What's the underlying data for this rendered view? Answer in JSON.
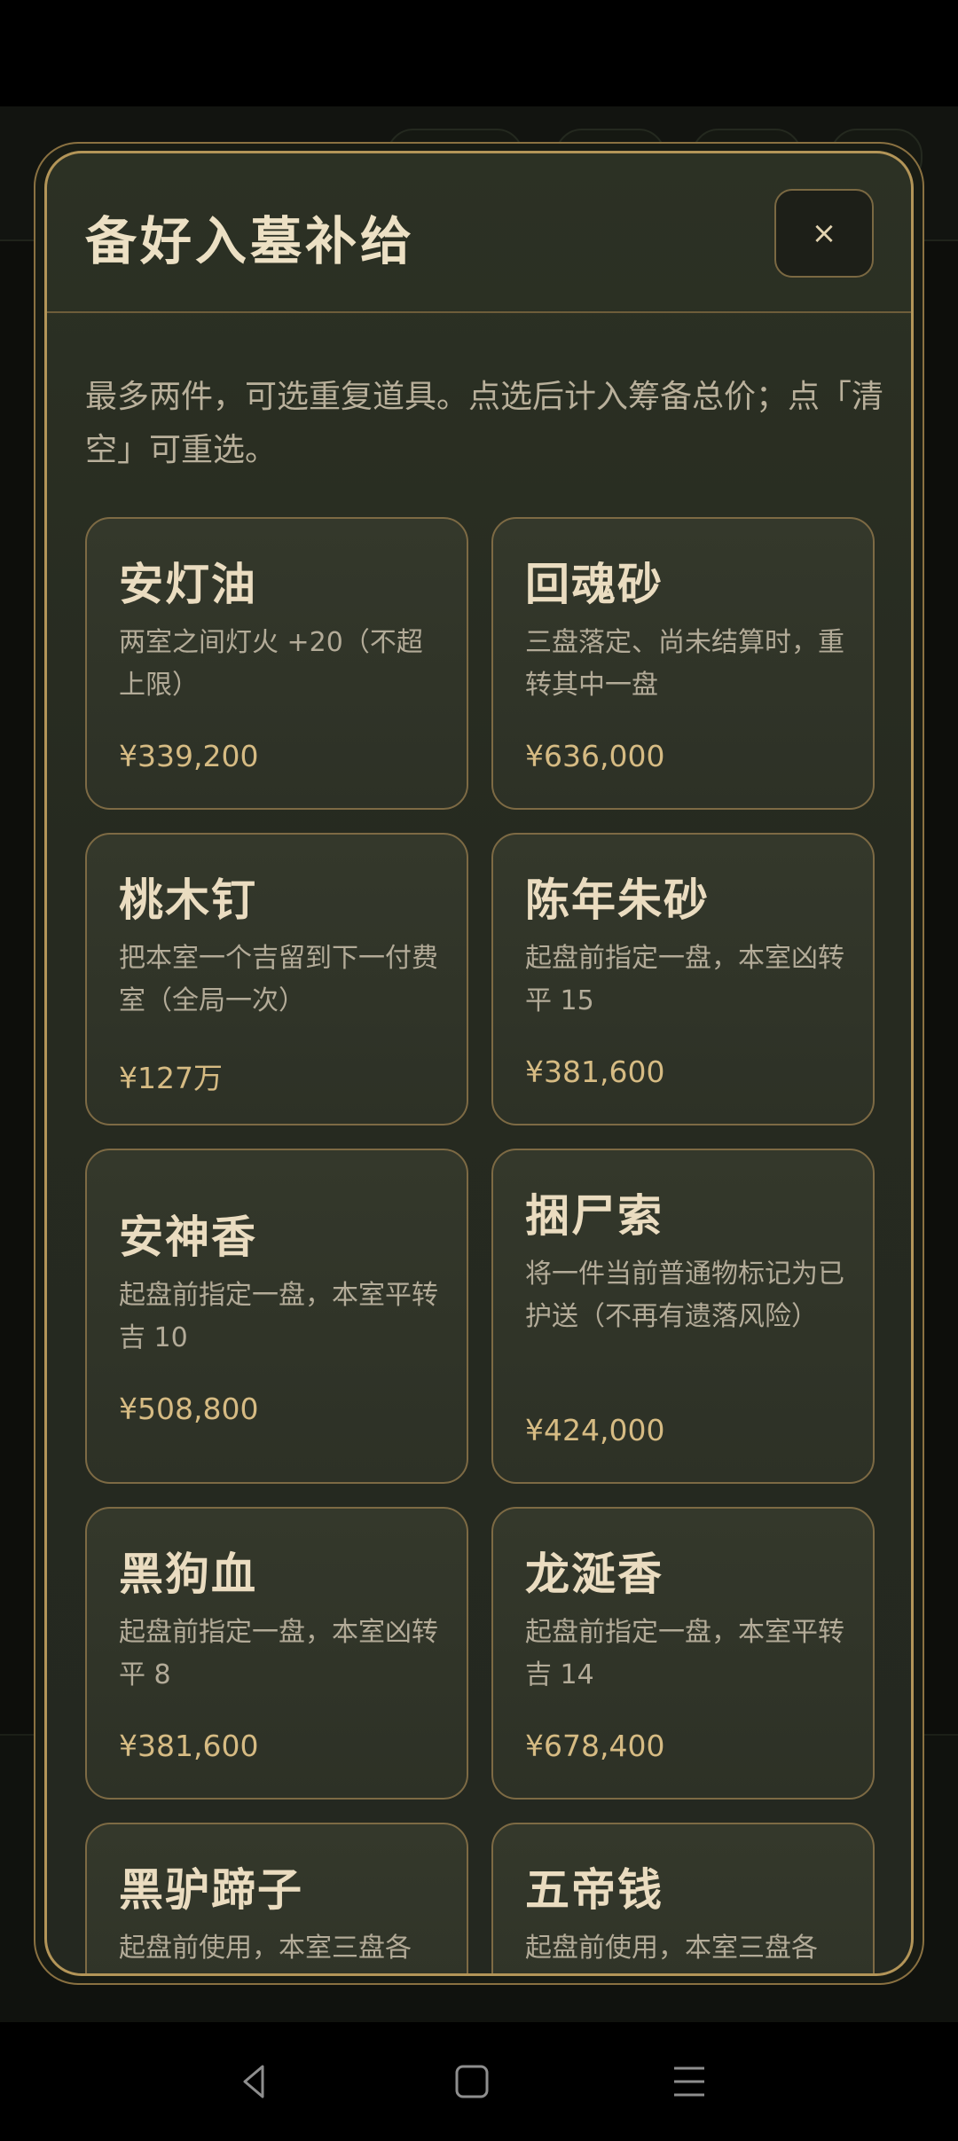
{
  "modal": {
    "title": "备好入墓补给",
    "close_label": "×",
    "intro": "最多两件，可选重复道具。点选后计入筹备总价；点「清空」可重选。"
  },
  "items": [
    {
      "name": "安灯油",
      "desc": "两室之间灯火 +20（不超上限）",
      "price": "¥339,200"
    },
    {
      "name": "回魂砂",
      "desc": "三盘落定、尚未结算时，重转其中一盘",
      "price": "¥636,000"
    },
    {
      "name": "桃木钉",
      "desc": "把本室一个吉留到下一付费室（全局一次）",
      "price": "¥127万"
    },
    {
      "name": "陈年朱砂",
      "desc": "起盘前指定一盘，本室凶转平 15",
      "price": "¥381,600"
    },
    {
      "name": "安神香",
      "desc": "起盘前指定一盘，本室平转吉 10",
      "price": "¥508,800"
    },
    {
      "name": "捆尸索",
      "desc": "将一件当前普通物标记为已护送（不再有遗落风险）",
      "price": "¥424,000"
    },
    {
      "name": "黑狗血",
      "desc": "起盘前指定一盘，本室凶转平 8",
      "price": "¥381,600"
    },
    {
      "name": "龙涎香",
      "desc": "起盘前指定一盘，本室平转吉 14",
      "price": "¥678,400"
    },
    {
      "name": "黑驴蹄子",
      "desc": "起盘前使用，本室三盘各",
      "price": ""
    },
    {
      "name": "五帝钱",
      "desc": "起盘前使用，本室三盘各",
      "price": ""
    }
  ],
  "navbar": {
    "icons": [
      "back-icon",
      "home-icon",
      "menu-icon"
    ]
  },
  "colors": {
    "accent_gold": "#b39558",
    "price_gold": "#d6bb83",
    "card_bg": "#34382b",
    "modal_bg": "#2c3124"
  }
}
